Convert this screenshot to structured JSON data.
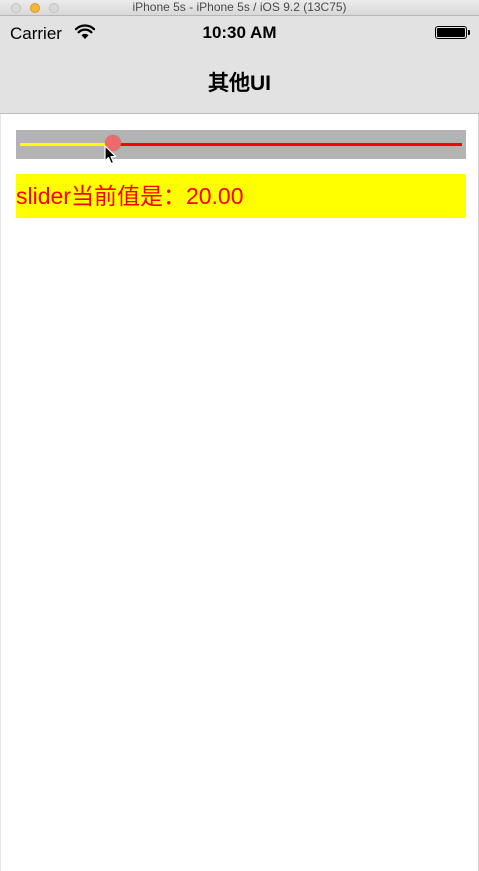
{
  "window": {
    "title": "iPhone 5s - iPhone 5s / iOS 9.2 (13C75)"
  },
  "status_bar": {
    "carrier": "Carrier",
    "time": "10:30 AM",
    "wifi_icon": "wifi-icon",
    "battery_icon": "battery-icon"
  },
  "nav": {
    "title": "其他UI"
  },
  "slider": {
    "value_fraction": 0.2,
    "min_track_color": "#ffff00",
    "max_track_color": "#ff0000",
    "background_color": "#b3b3b3",
    "thumb_color": "#ee6b6b"
  },
  "label": {
    "text": "slider当前值是：20.00",
    "text_color": "#ff0000",
    "background_color": "#ffff00"
  }
}
